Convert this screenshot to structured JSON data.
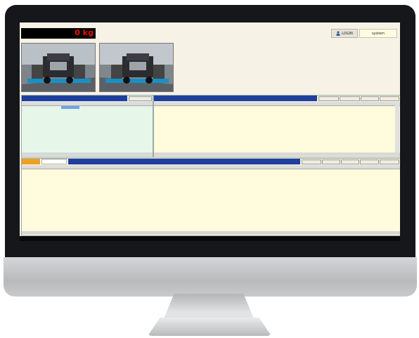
{
  "weight": {
    "label": "",
    "value": "0 kg"
  },
  "login": {
    "button_label": "LOGIN",
    "user": "system"
  },
  "header_info": [
    "",
    "",
    "",
    ""
  ],
  "list_panel": {
    "title": "",
    "button": "",
    "rows": [
      {
        "selected": true,
        "cells": [
          "",
          "",
          "",
          "",
          ""
        ]
      }
    ]
  },
  "first_weigh": {
    "title": "",
    "buttons": [
      "",
      "",
      "",
      ""
    ],
    "rows": [
      {
        "cells": [
          "",
          "",
          "",
          "",
          "",
          "",
          "",
          "",
          "",
          ""
        ]
      },
      {
        "cells": [
          "",
          "",
          "",
          "",
          "",
          "",
          "",
          "",
          "",
          ""
        ]
      },
      {
        "cells": [
          "",
          "",
          "",
          "",
          "",
          "",
          "",
          "",
          "",
          ""
        ]
      }
    ]
  },
  "second_weigh": {
    "title": "",
    "period_label": "",
    "date": "",
    "buttons": [
      "",
      "",
      "",
      "",
      ""
    ]
  },
  "status_bar": {
    "left": "",
    "right": ""
  },
  "colors": {
    "header_blue": "#1e3f9e",
    "header_text": "#ffe66a",
    "list_bg": "#e6f7ea",
    "grid_bg": "#fffbdc",
    "accent_orange": "#f0a020"
  }
}
